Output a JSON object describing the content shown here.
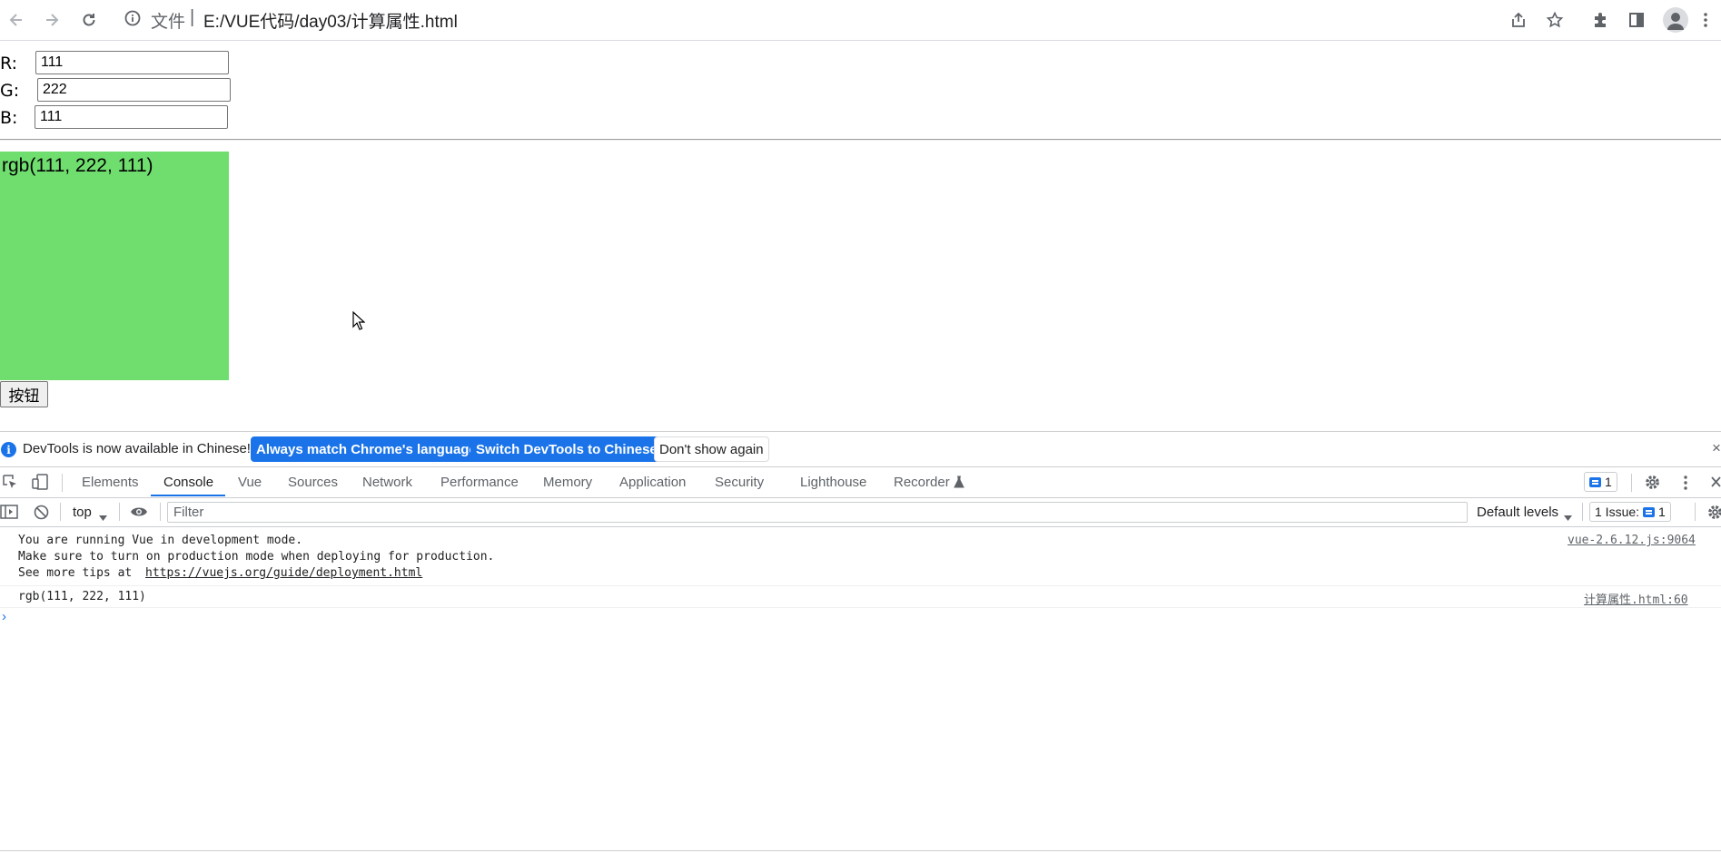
{
  "browser": {
    "address_scheme": "文件",
    "address_separator": "|",
    "address_url": "E:/VUE代码/day03/计算属性.html",
    "icons": [
      "back-icon",
      "forward-icon",
      "reload-icon",
      "info-icon",
      "share-icon",
      "star-icon",
      "extensions-icon",
      "sidebar-icon",
      "profile-icon",
      "more-icon"
    ]
  },
  "page": {
    "fields": [
      {
        "label": "R:",
        "value": "111"
      },
      {
        "label": "G:",
        "value": "222"
      },
      {
        "label": "B:",
        "value": "111"
      }
    ],
    "swatch_text": "rgb(111, 222, 111)",
    "swatch_color": "#6fde6f",
    "button_label": "按钮"
  },
  "devtools": {
    "infobar": {
      "message": "DevTools is now available in Chinese!",
      "btn_match": "Always match Chrome's language",
      "btn_switch": "Switch DevTools to Chinese",
      "btn_dismiss": "Don't show again",
      "close": "×"
    },
    "tabs": [
      "Elements",
      "Console",
      "Vue",
      "Sources",
      "Network",
      "Performance",
      "Memory",
      "Application",
      "Security",
      "Lighthouse",
      "Recorder"
    ],
    "active_tab": "Console",
    "issues_badge_count": "1",
    "console": {
      "context": "top",
      "filter_placeholder": "Filter",
      "levels": "Default levels",
      "issues_label": "1 Issue:",
      "issues_count": "1",
      "messages": [
        {
          "lines": [
            "You are running Vue in development mode.",
            "Make sure to turn on production mode when deploying for production.",
            "See more tips at "
          ],
          "link": "https://vuejs.org/guide/deployment.html",
          "source": "vue-2.6.12.js:9064"
        },
        {
          "lines": [
            "rgb(111, 222, 111)"
          ],
          "source": "计算属性.html:60"
        }
      ],
      "prompt": "›"
    },
    "accent": "#1a73e8"
  }
}
